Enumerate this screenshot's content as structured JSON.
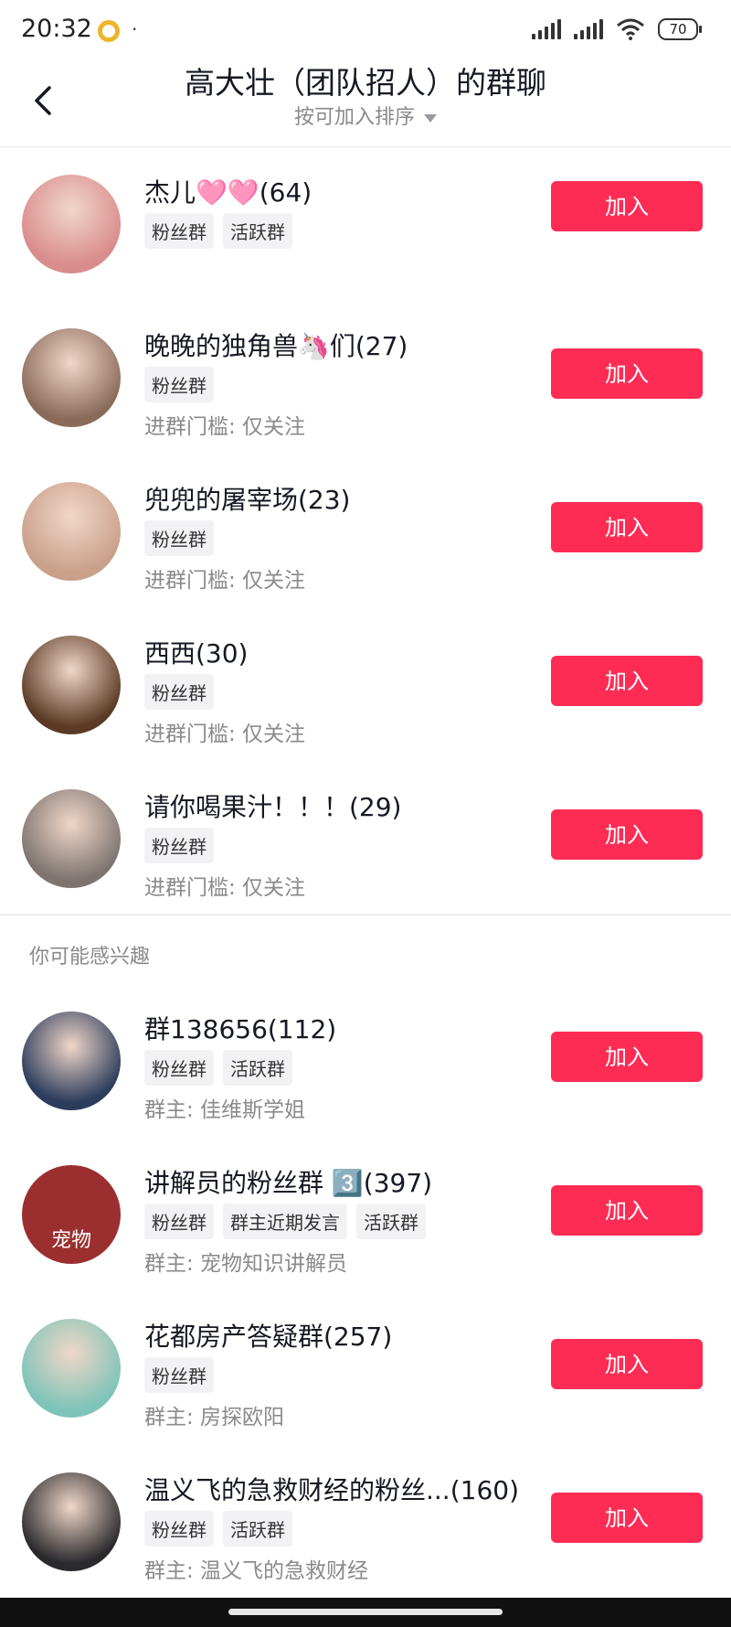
{
  "status": {
    "time": "20:32",
    "battery": "70",
    "dot": "·"
  },
  "header": {
    "back_label": "<",
    "title": "高大壮（团队招人）的群聊",
    "sort_label": "按可加入排序"
  },
  "groups": [
    {
      "name": "杰儿🩷🩷(64)",
      "tags": [
        "粉丝群",
        "活跃群"
      ],
      "sub": "",
      "button": "加入",
      "avatar_color": "#d98c8c"
    },
    {
      "name": "晚晚的独角兽🦄们(27)",
      "tags": [
        "粉丝群"
      ],
      "sub": "进群门槛: 仅关注",
      "button": "加入",
      "avatar_color": "#8a6b5a"
    },
    {
      "name": "兜兜的屠宰场(23)",
      "tags": [
        "粉丝群"
      ],
      "sub": "进群门槛: 仅关注",
      "button": "加入",
      "avatar_color": "#c9a08a"
    },
    {
      "name": " 西西(30)",
      "tags": [
        "粉丝群"
      ],
      "sub": "进群门槛: 仅关注",
      "button": "加入",
      "avatar_color": "#5a3a24"
    },
    {
      "name": "请你喝果汁！！！(29)",
      "tags": [
        "粉丝群"
      ],
      "sub": "进群门槛: 仅关注",
      "button": "加入",
      "avatar_color": "#7d7470"
    }
  ],
  "section_title": "你可能感兴趣",
  "suggested": [
    {
      "name": "群138656(112)",
      "tags": [
        "粉丝群",
        "活跃群"
      ],
      "sub": "群主: 佳维斯学姐",
      "button": "加入",
      "avatar_color": "#2b3c5c"
    },
    {
      "name": "讲解员的粉丝群 3️⃣(397)",
      "tags": [
        "粉丝群",
        "群主近期发言",
        "活跃群"
      ],
      "sub": "群主: 宠物知识讲解员",
      "button": "加入",
      "avatar_color": "#9b2f2f",
      "avatar_text": "宠物"
    },
    {
      "name": "花都房产答疑群(257)",
      "tags": [
        "粉丝群"
      ],
      "sub": "群主: 房探欧阳",
      "button": "加入",
      "avatar_color": "#7ec4b8"
    },
    {
      "name": "温义飞的急救财经的粉丝...(160)",
      "tags": [
        "粉丝群",
        "活跃群"
      ],
      "sub": "群主: 温义飞的急救财经",
      "button": "加入",
      "avatar_color": "#2a2a2e"
    }
  ],
  "colors": {
    "accent": "#fe2c55",
    "tag_bg": "#f2f2f4",
    "muted": "#8a8a8f"
  }
}
